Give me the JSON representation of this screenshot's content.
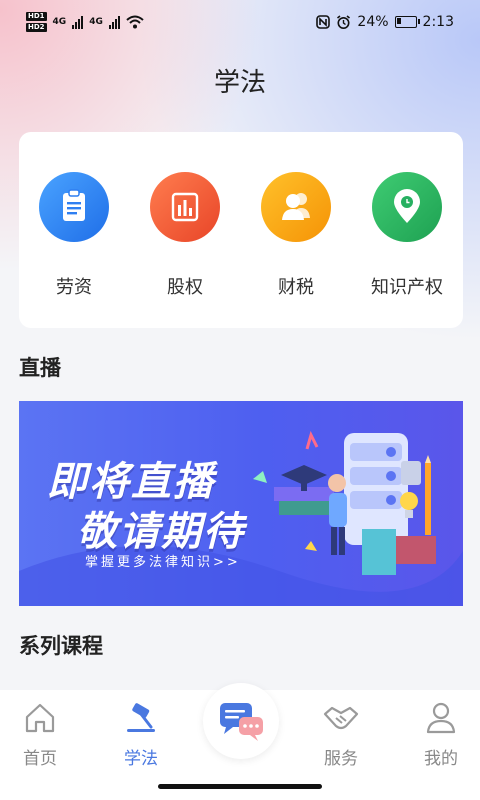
{
  "status_bar": {
    "sim1": "HD1",
    "sim2": "HD2",
    "net1": "4G",
    "net2": "4G",
    "battery": "24%",
    "battery_level": 0.24,
    "time": "2:13"
  },
  "page": {
    "title": "学法"
  },
  "categories": [
    {
      "label": "劳资",
      "color": "#2f7ff1",
      "icon": "clipboard-icon"
    },
    {
      "label": "股权",
      "color": "#f2583b",
      "icon": "bar-chart-icon"
    },
    {
      "label": "财税",
      "color": "#f7a30d",
      "icon": "people-icon"
    },
    {
      "label": "知识产权",
      "color": "#27b061",
      "icon": "location-pin-icon"
    }
  ],
  "live": {
    "heading": "直播",
    "banner_line1": "即将直播",
    "banner_line2": "敬请期待",
    "banner_sub": "掌握更多法律知识>>"
  },
  "courses": {
    "heading": "系列课程"
  },
  "tabbar": {
    "tabs": [
      {
        "label": "首页",
        "icon": "home-icon",
        "active": false
      },
      {
        "label": "学法",
        "icon": "gavel-icon",
        "active": true
      },
      {
        "label": "服务",
        "icon": "handshake-icon",
        "active": false
      },
      {
        "label": "我的",
        "icon": "person-icon",
        "active": false
      }
    ],
    "center_icon": "chat-bubbles-icon"
  },
  "colors": {
    "accent": "#4a78e0",
    "banner": "#5265ef"
  }
}
